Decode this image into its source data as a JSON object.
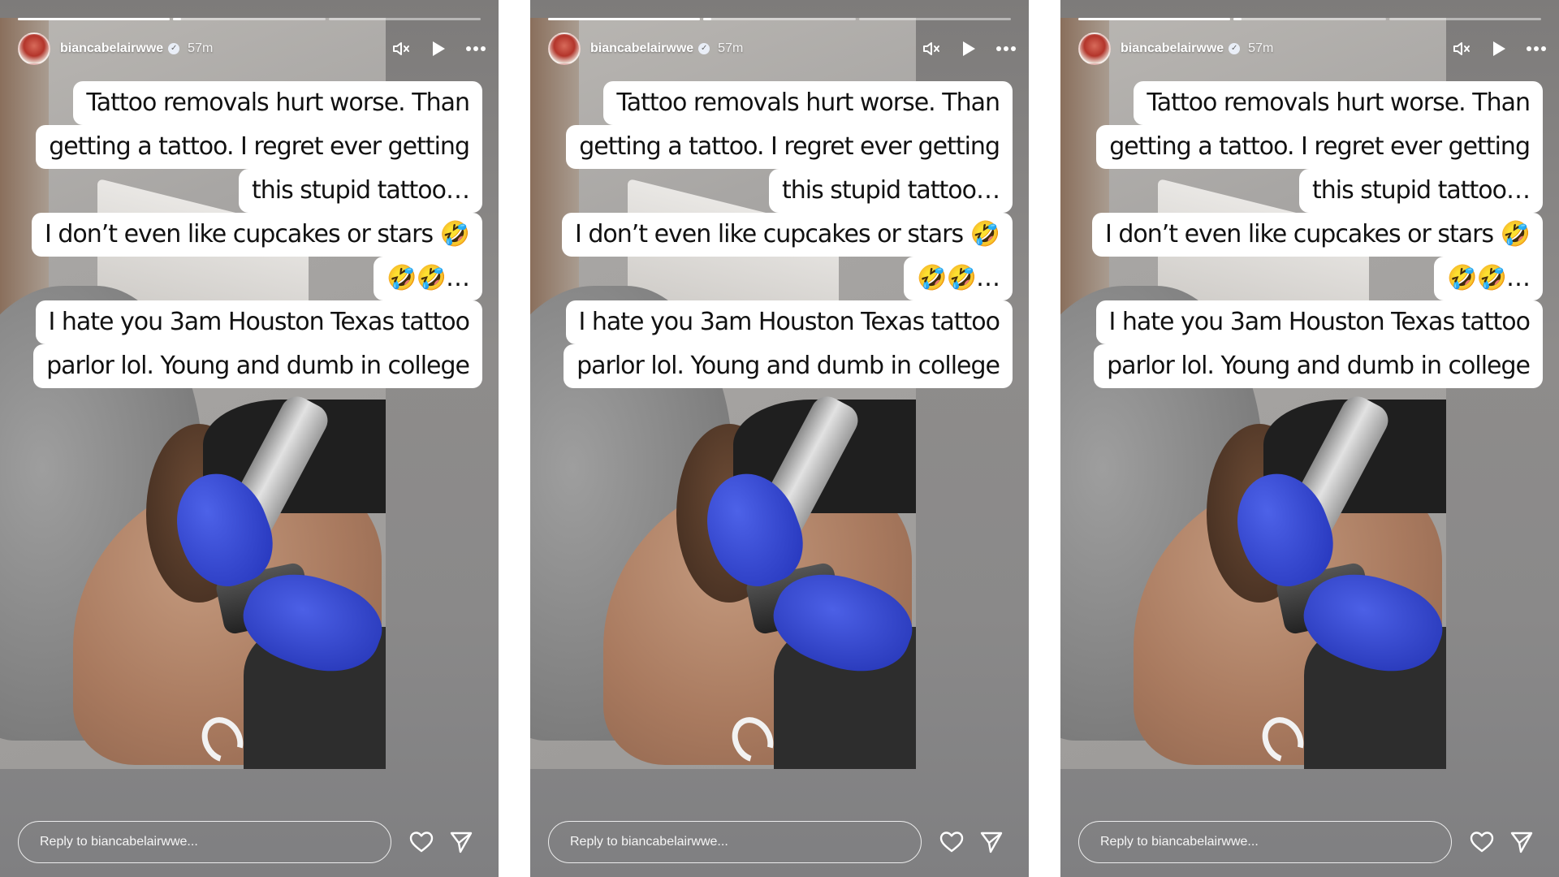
{
  "stories": [
    {
      "username": "biancabelairwwe",
      "time": "57m",
      "progress": [
        1,
        0.05,
        0
      ],
      "caption_lines": [
        "Tattoo removals hurt worse. Than",
        "getting a tattoo. I regret ever getting",
        "this stupid tattoo…",
        "I don’t even like cupcakes or stars 🤣",
        "🤣🤣…",
        "I hate you  3am Houston Texas tattoo",
        "parlor lol. Young and dumb in college"
      ],
      "reply_placeholder": "Reply to biancabelairwwe..."
    },
    {
      "username": "biancabelairwwe",
      "time": "57m",
      "progress": [
        1,
        0.05,
        0
      ],
      "caption_lines": [
        "Tattoo removals hurt worse. Than",
        "getting a tattoo. I regret ever getting",
        "this stupid tattoo…",
        "I don’t even like cupcakes or stars 🤣",
        "🤣🤣…",
        "I hate you  3am Houston Texas tattoo",
        "parlor lol. Young and dumb in college"
      ],
      "reply_placeholder": "Reply to biancabelairwwe..."
    },
    {
      "username": "biancabelairwwe",
      "time": "57m",
      "progress": [
        1,
        0.05,
        0
      ],
      "caption_lines": [
        "Tattoo removals hurt worse. Than",
        "getting a tattoo. I regret ever getting",
        "this stupid tattoo…",
        "I don’t even like cupcakes or stars 🤣",
        "🤣🤣…",
        "I hate you  3am Houston Texas tattoo",
        "parlor lol. Young and dumb in college"
      ],
      "reply_placeholder": "Reply to biancabelairwwe..."
    }
  ],
  "icons": {
    "mute": "speaker-muted-icon",
    "play": "play-icon",
    "more": "more-options-icon",
    "verified": "verified-badge-icon",
    "like": "heart-icon",
    "share": "send-icon"
  },
  "colors": {
    "caption_bg": "#ffffff",
    "caption_text": "#111111",
    "overlay_text": "#ffffff"
  }
}
